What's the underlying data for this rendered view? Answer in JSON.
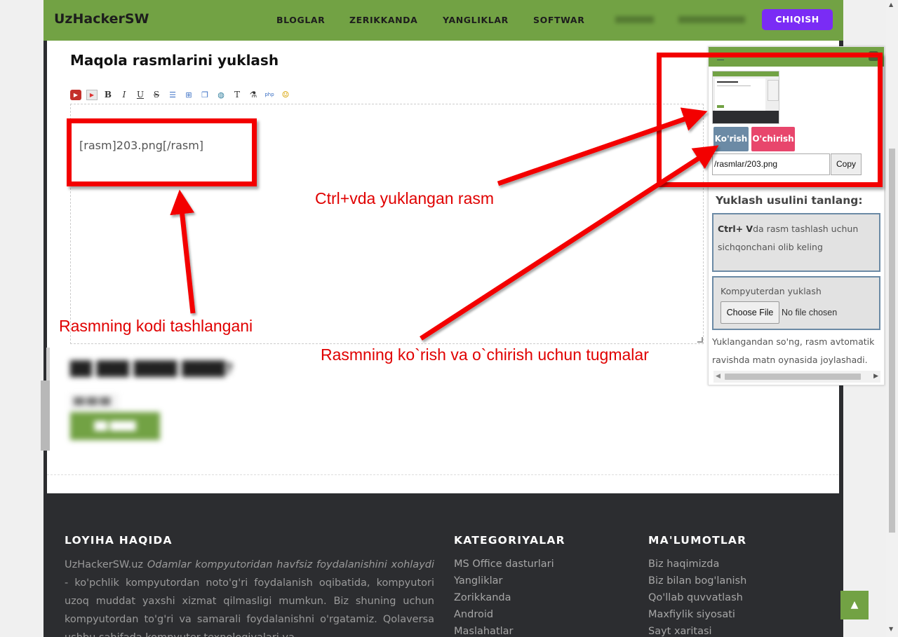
{
  "header": {
    "logo": "UzHackerSW",
    "nav": [
      "BLOGLAR",
      "ZERIKKANDA",
      "YANGLIKLAR",
      "SOFTWAR"
    ],
    "logout": "CHIQISH"
  },
  "editor": {
    "title": "Maqola rasmlarini yuklash",
    "content": "[rasm]203.png[/rasm]",
    "toolbar": [
      "youtube-icon",
      "video-icon",
      "bold-icon",
      "italic-icon",
      "underline-icon",
      "strike-icon",
      "list-icon",
      "link-icon",
      "copy-icon",
      "globe-icon",
      "text-color-icon",
      "paint-icon",
      "php-icon",
      "smiley-icon"
    ]
  },
  "panel": {
    "view_button": "Ko'rish",
    "delete_button": "O'chirish",
    "path_value": "/rasmlar/203.png",
    "copy_button": "Copy",
    "heading": "Yuklash usulini tanlang:",
    "paste_bold": "Ctrl+ V",
    "paste_text": "da rasm tashlash uchun sichqonchani olib keling",
    "upload_label": "Kompyuterdan yuklash",
    "choose_file": "Choose File",
    "no_file": "No file chosen",
    "note": "Yuklangandan so'ng, rasm avtomatik ravishda matn oynasida joylashadi."
  },
  "annotations": {
    "pasted_image": "Ctrl+vda yuklangan rasm",
    "image_code": "Rasmning kodi tashlangani",
    "buttons": "Rasmning ko`rish va o`chirish uchun tugmalar"
  },
  "footer": {
    "about_heading": "LOYIHA HAQIDA",
    "about_site": "UzHackerSW.uz",
    "about_italic": "Odamlar kompyutoridan havfsiz foydalanishini xohlaydi",
    "about_rest": " - ko'pchlik kompyutordan noto'g'ri foydalanish oqibatida, kompyutori uzoq muddat yaxshi xizmat qilmasligi mumkun. Biz shuning uchun kompyutordan to'g'ri va samarali foydalanishni o'rgatamiz. Qolaversa ushbu sahifada kompyuter texnologiyalari va",
    "categories_heading": "KATEGORIYALAR",
    "categories": [
      "MS Office dasturlari",
      "Yangliklar",
      "Zorikkanda",
      "Android",
      "Maslahatlar"
    ],
    "info_heading": "MA'LUMOTLAR",
    "info": [
      "Biz haqimizda",
      "Biz bilan bog'lanish",
      "Qo'llab quvvatlash",
      "Maxfiylik siyosati",
      "Sayt xaritasi"
    ]
  },
  "colors": {
    "brand_green": "#72a244",
    "logout_purple": "#7a2cf5",
    "annotation_red": "#f30000",
    "delete_pink": "#e8466c",
    "view_blue": "#6b8aa5",
    "footer_dark": "#2c2d30"
  }
}
